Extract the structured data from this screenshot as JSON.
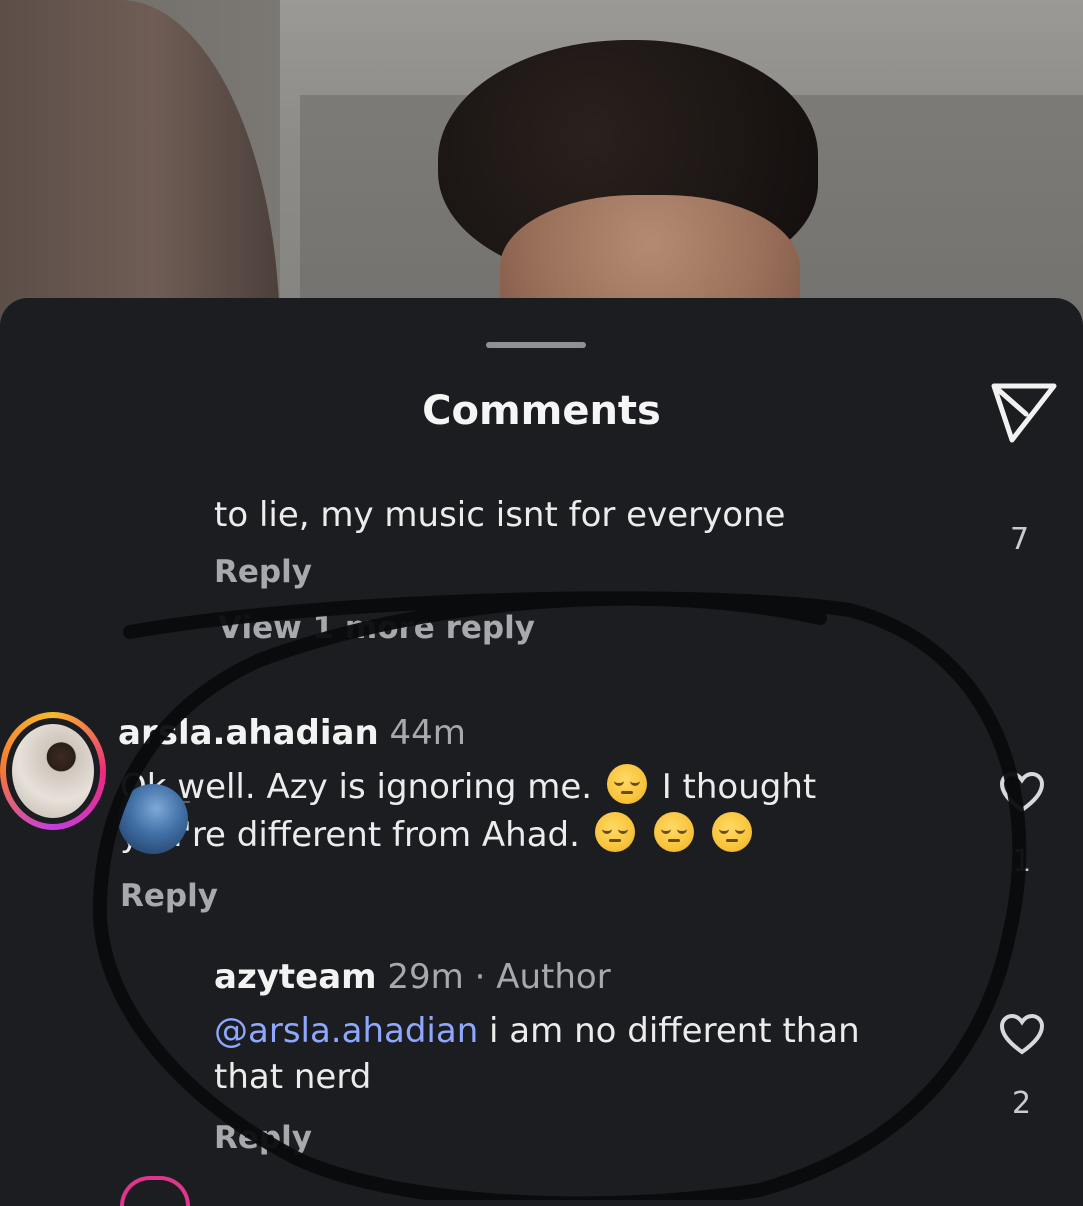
{
  "header": {
    "title": "Comments"
  },
  "icons": {
    "send": "send-icon",
    "like": "heart-icon"
  },
  "colors": {
    "sheet_bg": "#1b1d21",
    "mention": "#8fa8ff",
    "muted": "#a7a9ad"
  },
  "comments": {
    "cut_text": "to lie, my music isnt for everyone",
    "cut_likes": "7",
    "cut_reply_label": "Reply",
    "view_more": "View 1 more reply",
    "main": {
      "username": "arsla.ahadian",
      "time": "44m",
      "text1": "Ok well. Azy is ignoring me.",
      "text2": "I thought",
      "text3": "you're different from Ahad.",
      "reply_label": "Reply",
      "likes": "1"
    },
    "reply": {
      "username": "azyteam",
      "time": "29m",
      "separator": "·",
      "badge": "Author",
      "mention": "@arsla.ahadian",
      "text1": " i am no different than",
      "text2": "that nerd",
      "reply_label": "Reply",
      "likes": "2"
    }
  }
}
